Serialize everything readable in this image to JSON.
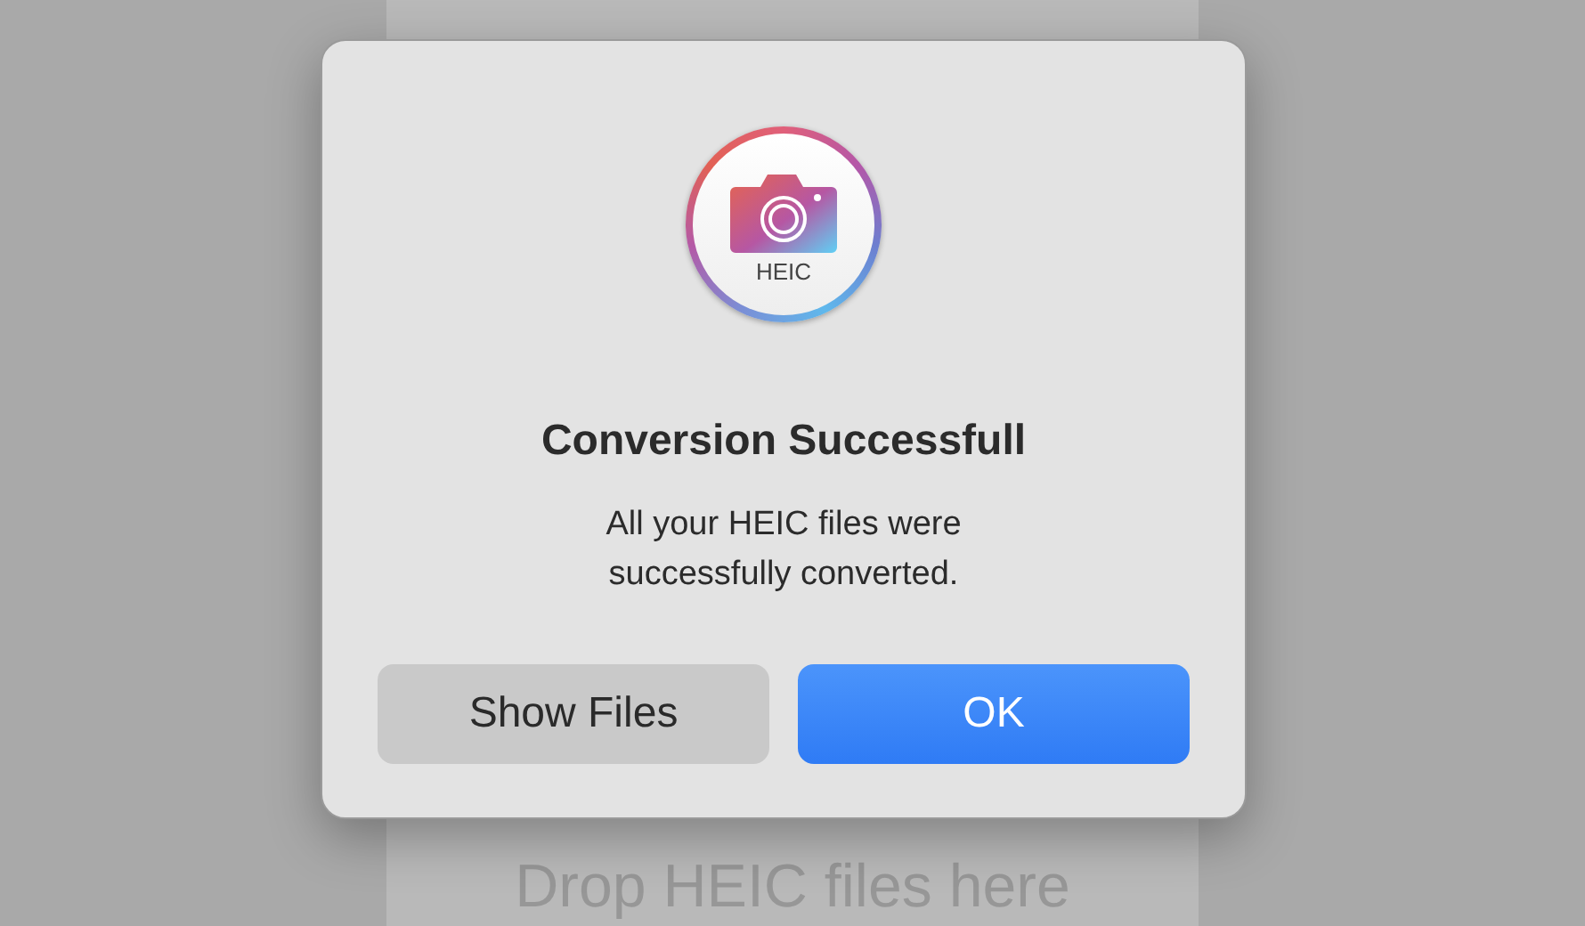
{
  "background": {
    "drop_hint": "Drop HEIC files here"
  },
  "dialog": {
    "icon_label": "HEIC",
    "title": "Conversion Successfull",
    "message": "All your HEIC files were successfully converted.",
    "buttons": [
      {
        "label": "Show Files",
        "kind": "secondary"
      },
      {
        "label": "OK",
        "kind": "primary"
      }
    ]
  }
}
